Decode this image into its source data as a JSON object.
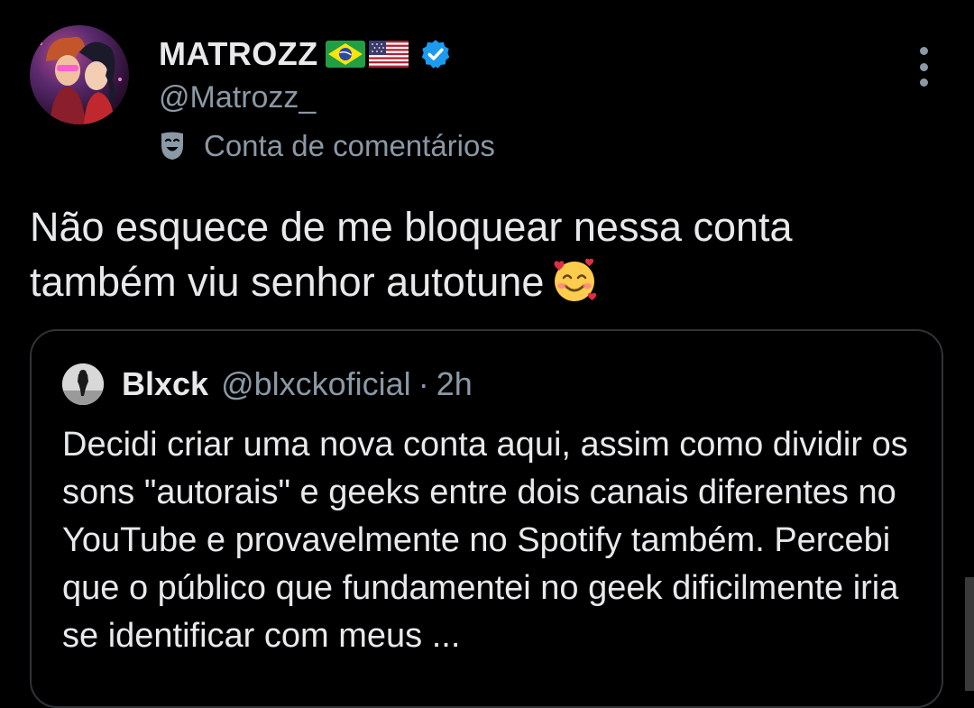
{
  "author": {
    "display_name": "MATROZZ",
    "flags": [
      "brazil-flag",
      "usa-flag"
    ],
    "verified": true,
    "handle": "@Matrozz_",
    "account_label": "Conta de comentários"
  },
  "tweet": {
    "text": "Não esquece de me bloquear nessa conta também viu senhor autotune",
    "emoji": "smiling-face-with-hearts"
  },
  "quoted_tweet": {
    "name": "Blxck",
    "handle": "@blxckoficial",
    "separator": "·",
    "time": "2h",
    "text": "Decidi criar uma nova conta aqui, assim como dividir os sons \"autorais\" e geeks entre dois canais diferentes no YouTube e provavelmente no Spotify também. Percebi que o público que fundamentei no geek dificilmente iria se identificar com meus ..."
  },
  "colors": {
    "background": "#000000",
    "text_primary": "#e7e9ea",
    "text_secondary": "#8b98a5",
    "border": "#2f3336",
    "verified_blue": "#1d9bf0"
  }
}
